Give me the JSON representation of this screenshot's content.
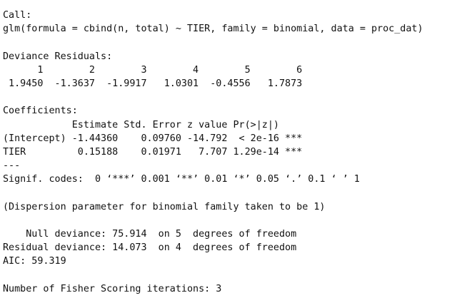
{
  "output": {
    "lines": [
      "Call:",
      "glm(formula = cbind(n, total) ~ TIER, family = binomial, data = proc_dat)",
      "",
      "Deviance Residuals:",
      "      1        2        3        4        5        6  ",
      " 1.9450  -1.3637  -1.9917   1.0301  -0.4556   1.7873  ",
      "",
      "Coefficients:",
      "            Estimate Std. Error z value Pr(>|z|)    ",
      "(Intercept) -1.44360    0.09760 -14.792  < 2e-16 ***",
      "TIER         0.15188    0.01971   7.707 1.29e-14 ***",
      "---",
      "Signif. codes:  0 ‘***’ 0.001 ‘**’ 0.01 ‘*’ 0.05 ‘.’ 0.1 ‘ ’ 1",
      "",
      "(Dispersion parameter for binomial family taken to be 1)",
      "",
      "    Null deviance: 75.914  on 5  degrees of freedom",
      "Residual deviance: 14.073  on 4  degrees of freedom",
      "AIC: 59.319",
      "",
      "Number of Fisher Scoring iterations: 3"
    ]
  }
}
